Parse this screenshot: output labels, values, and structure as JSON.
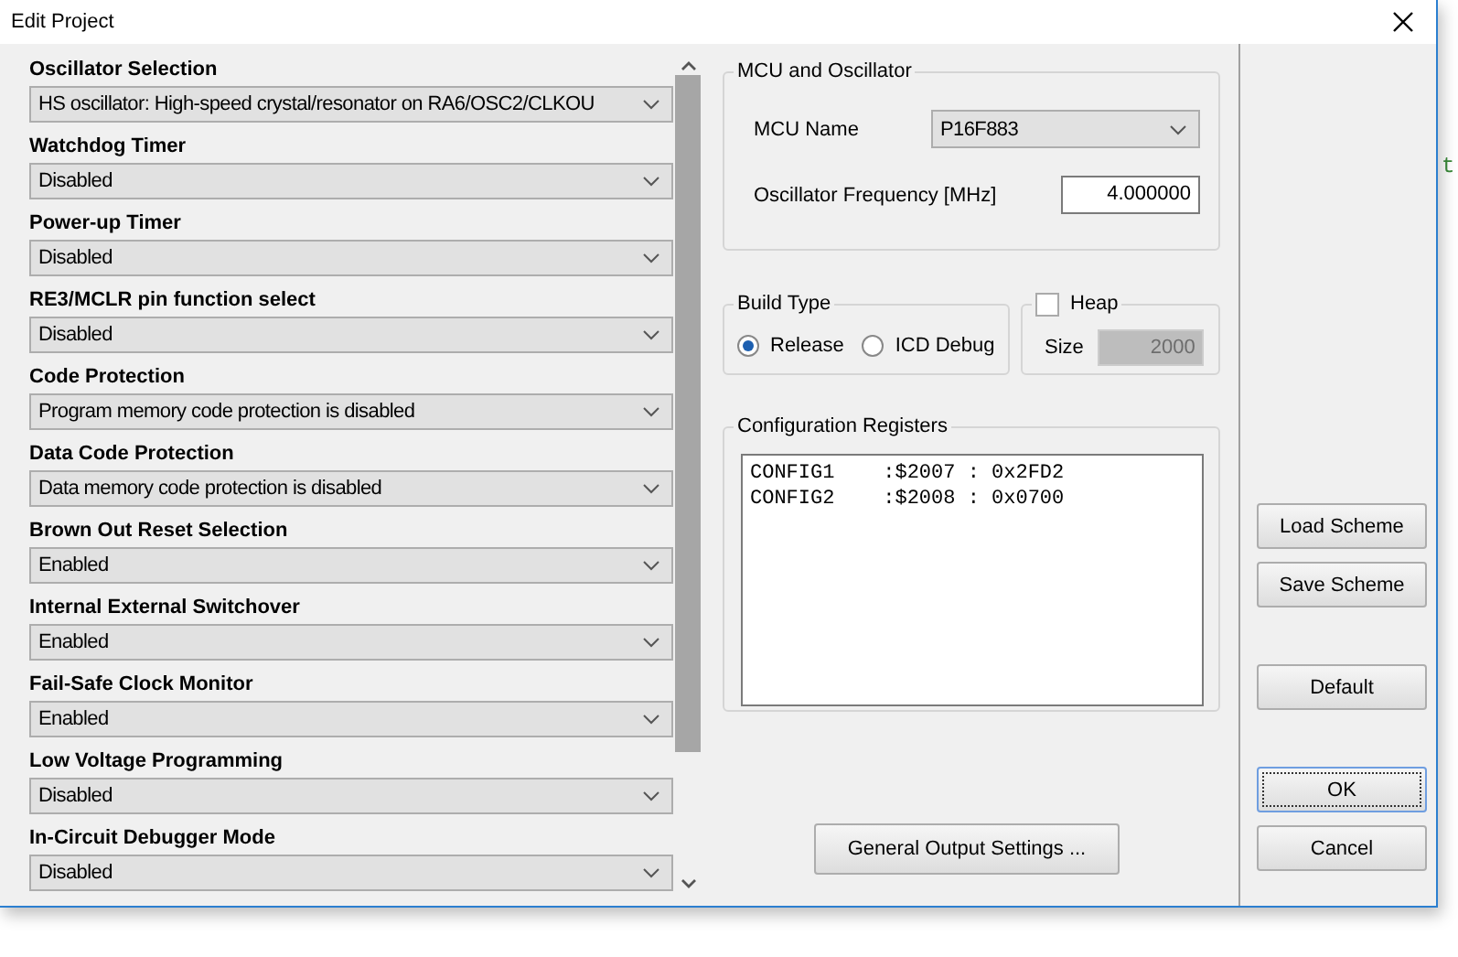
{
  "window": {
    "title": "Edit Project"
  },
  "settings": [
    {
      "label": "Oscillator Selection",
      "value": "HS oscillator: High-speed crystal/resonator on RA6/OSC2/CLKOU"
    },
    {
      "label": "Watchdog Timer",
      "value": "Disabled"
    },
    {
      "label": "Power-up Timer",
      "value": "Disabled"
    },
    {
      "label": "RE3/MCLR pin function select",
      "value": "Disabled"
    },
    {
      "label": "Code Protection",
      "value": "Program memory code protection is disabled"
    },
    {
      "label": "Data Code Protection",
      "value": "Data memory code protection is disabled"
    },
    {
      "label": "Brown Out Reset Selection",
      "value": "Enabled"
    },
    {
      "label": "Internal External Switchover",
      "value": "Enabled"
    },
    {
      "label": "Fail-Safe Clock Monitor",
      "value": "Enabled"
    },
    {
      "label": "Low Voltage Programming",
      "value": "Disabled"
    },
    {
      "label": "In-Circuit Debugger Mode",
      "value": "Disabled"
    }
  ],
  "mcu": {
    "title": "MCU and Oscillator",
    "name_label": "MCU Name",
    "name_value": "P16F883",
    "freq_label": "Oscillator Frequency [MHz]",
    "freq_value": "4.000000"
  },
  "build_type": {
    "title": "Build Type",
    "options": [
      {
        "label": "Release",
        "selected": true
      },
      {
        "label": "ICD Debug",
        "selected": false
      }
    ]
  },
  "heap": {
    "label": "Heap",
    "checked": false,
    "size_label": "Size",
    "size_value": "2000",
    "disabled": true
  },
  "config": {
    "title": "Configuration Registers",
    "lines": [
      "CONFIG1    :$2007 : 0x2FD2",
      "CONFIG2    :$2008 : 0x0700"
    ]
  },
  "general_button": "General Output Settings ...",
  "side_buttons": [
    {
      "label": "Load Scheme",
      "focused": false
    },
    {
      "label": "Save Scheme",
      "focused": false
    },
    {
      "label": "Default",
      "focused": false
    },
    {
      "label": "OK",
      "focused": true
    },
    {
      "label": "Cancel",
      "focused": false
    }
  ],
  "background_text": "t"
}
